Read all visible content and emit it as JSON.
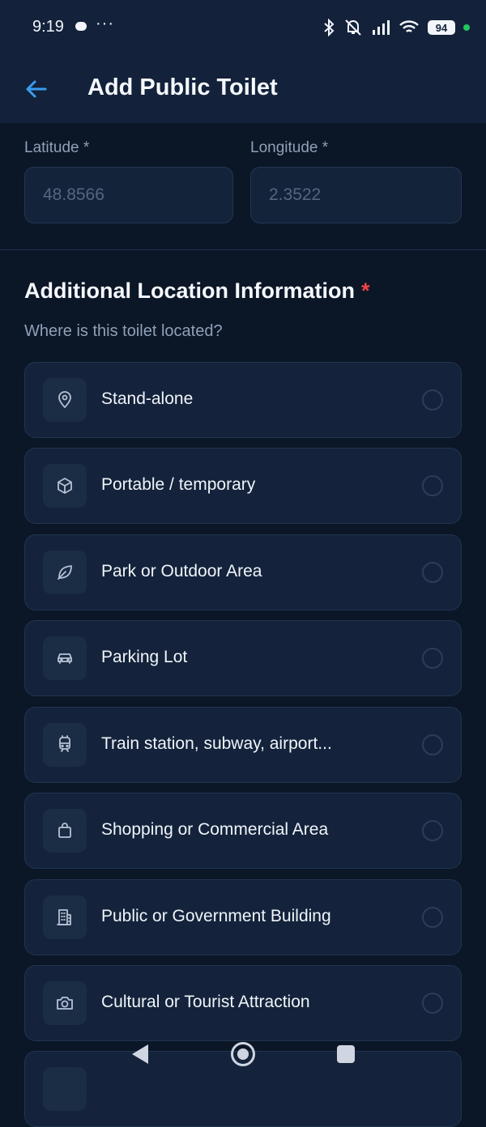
{
  "status": {
    "time": "9:19",
    "more": "···",
    "battery": "94"
  },
  "appbar": {
    "title": "Add Public Toilet"
  },
  "coordinates": {
    "latitude_label": "Latitude *",
    "latitude_placeholder": "48.8566",
    "longitude_label": "Longitude *",
    "longitude_placeholder": "2.3522"
  },
  "section": {
    "title": "Additional Location Information",
    "required": "*",
    "subtitle": "Where is this toilet located?"
  },
  "options": [
    {
      "label": "Stand-alone",
      "icon": "map-pin-icon"
    },
    {
      "label": "Portable / temporary",
      "icon": "box-icon"
    },
    {
      "label": "Park or Outdoor Area",
      "icon": "leaf-icon"
    },
    {
      "label": "Parking Lot",
      "icon": "car-icon"
    },
    {
      "label": "Train station, subway, airport...",
      "icon": "train-icon"
    },
    {
      "label": "Shopping or Commercial Area",
      "icon": "shopping-bag-icon"
    },
    {
      "label": "Public or Government Building",
      "icon": "building-icon"
    },
    {
      "label": "Cultural or Tourist Attraction",
      "icon": "camera-icon"
    }
  ],
  "colors": {
    "background": "#0b1627",
    "card": "#14233b",
    "accent": "#3b9cf0",
    "required": "#ef4444"
  }
}
